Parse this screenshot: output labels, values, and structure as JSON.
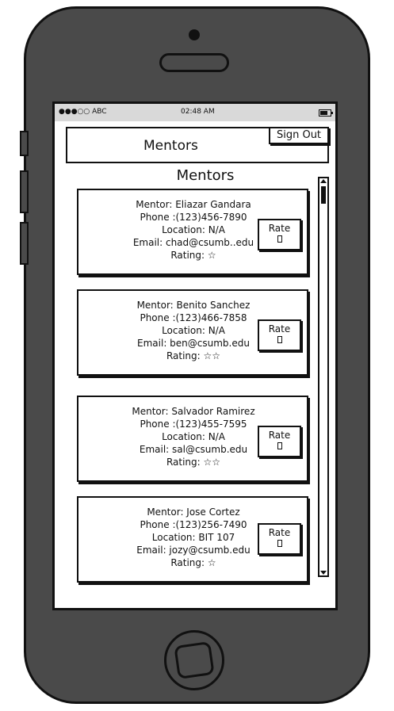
{
  "status_bar": {
    "carrier": "●●●○○ ABC",
    "time": "02:48 AM"
  },
  "header": {
    "title": "Mentors",
    "sign_out_label": "Sign Out"
  },
  "section_title": "Mentors",
  "mentors": [
    {
      "mentor": "Mentor: Eliazar Gandara",
      "phone": "Phone :(123)456-7890",
      "location": "Location: N/A",
      "email": "Email: chad@csumb..edu",
      "rating": "Rating: ☆",
      "rate_label": "Rate"
    },
    {
      "mentor": "Mentor: Benito Sanchez",
      "phone": "Phone :(123)466-7858",
      "location": "Location: N/A",
      "email": "Email: ben@csumb.edu",
      "rating": "Rating: ☆☆",
      "rate_label": "Rate"
    },
    {
      "mentor": "Mentor: Salvador Ramirez",
      "phone": "Phone :(123)455-7595",
      "location": "Location: N/A",
      "email": "Email: sal@csumb.edu",
      "rating": "Rating: ☆☆",
      "rate_label": "Rate"
    },
    {
      "mentor": "Mentor: Jose Cortez",
      "phone": "Phone :(123)256-7490",
      "location": "Location: BIT 107",
      "email": "Email: jozy@csumb.edu",
      "rating": "Rating: ☆",
      "rate_label": "Rate"
    }
  ]
}
